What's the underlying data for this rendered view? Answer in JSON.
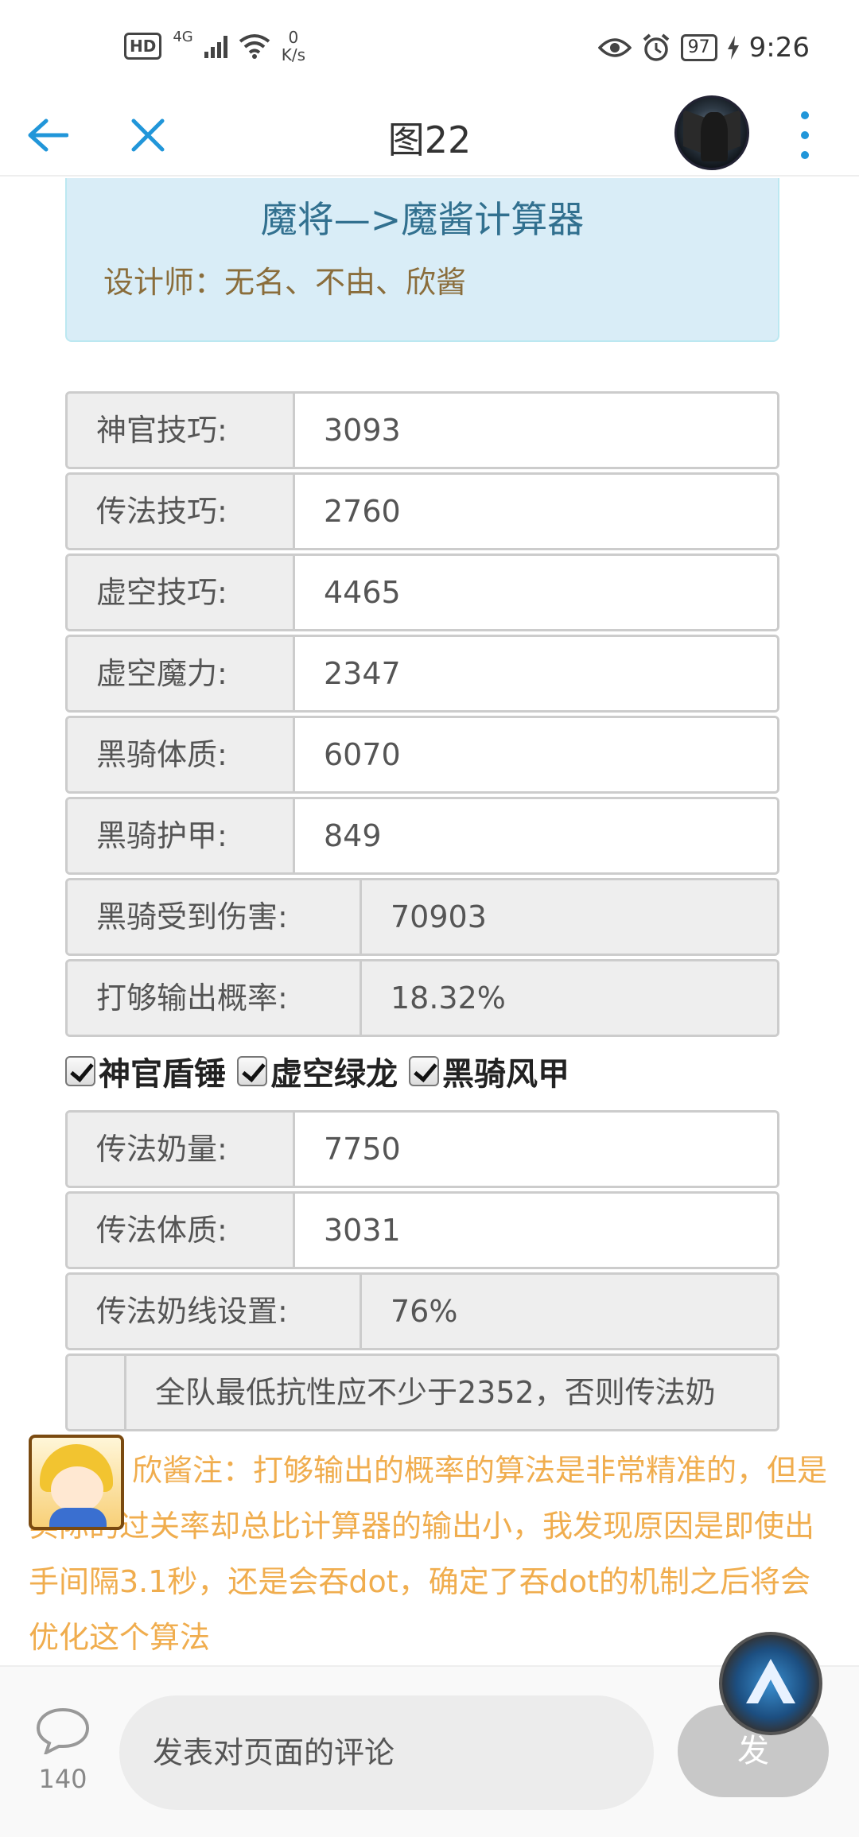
{
  "status_bar": {
    "hd": "HD",
    "network": "4G",
    "net_speed_value": "0",
    "net_speed_unit": "K/s",
    "battery": "97",
    "time": "9:26"
  },
  "header": {
    "title": "图22"
  },
  "calculator": {
    "title": "魔将—>魔酱计算器",
    "designers": "设计师：无名、不由、欣酱"
  },
  "fields_top": [
    {
      "label": "神官技巧:",
      "value": "3093"
    },
    {
      "label": "传法技巧:",
      "value": "2760"
    },
    {
      "label": "虚空技巧:",
      "value": "4465"
    },
    {
      "label": "虚空魔力:",
      "value": "2347"
    },
    {
      "label": "黑骑体质:",
      "value": "6070"
    },
    {
      "label": "黑骑护甲:",
      "value": "849"
    }
  ],
  "results_top": [
    {
      "label": "黑骑受到伤害:",
      "value": "70903"
    },
    {
      "label": "打够输出概率:",
      "value": "18.32%"
    }
  ],
  "checkboxes": [
    {
      "label": "神官盾锤",
      "checked": true
    },
    {
      "label": "虚空绿龙",
      "checked": true
    },
    {
      "label": "黑骑风甲",
      "checked": true
    }
  ],
  "fields_bottom": [
    {
      "label": "传法奶量:",
      "value": "7750"
    },
    {
      "label": "传法体质:",
      "value": "3031"
    }
  ],
  "results_bottom": [
    {
      "label": "传法奶线设置:",
      "value": "76%"
    }
  ],
  "resist_note": "全队最低抗性应不少于2352，否则传法奶",
  "comment": {
    "text": "欣酱注：打够输出的概率的算法是非常精准的，但是实际的过关率却总比计算器的输出小，我发现原因是即使出手间隔3.1秒，还是会吞dot，确定了吞dot的机制之后将会优化这个算法"
  },
  "bottom_bar": {
    "comment_count": "140",
    "input_placeholder": "发表对页面的评论",
    "send_label": "发"
  },
  "colors": {
    "accent": "#2196d9",
    "info_bg": "#d9edf7",
    "info_title": "#31708f",
    "note_text": "#f0ad4e"
  }
}
